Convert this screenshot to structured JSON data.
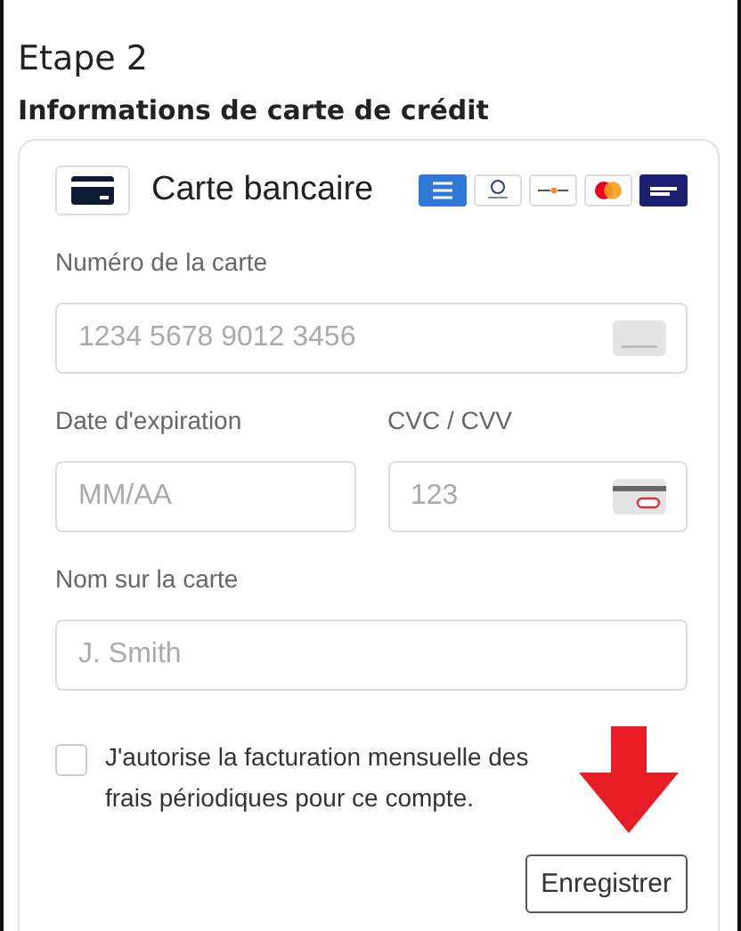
{
  "step_title": "Etape 2",
  "section_title": "Informations de carte de crédit",
  "payment_method": {
    "label": "Carte bancaire"
  },
  "fields": {
    "card_number": {
      "label": "Numéro de la carte",
      "placeholder": "1234 5678 9012 3456"
    },
    "expiry": {
      "label": "Date d'expiration",
      "placeholder": "MM/AA"
    },
    "cvc": {
      "label": "CVC / CVV",
      "placeholder": "123"
    },
    "name": {
      "label": "Nom sur la carte",
      "placeholder": "J. Smith"
    }
  },
  "consent": {
    "checked": false,
    "text": "J'autorise la facturation mensuelle des frais périodiques pour ce compte."
  },
  "save_button": "Enregistrer"
}
